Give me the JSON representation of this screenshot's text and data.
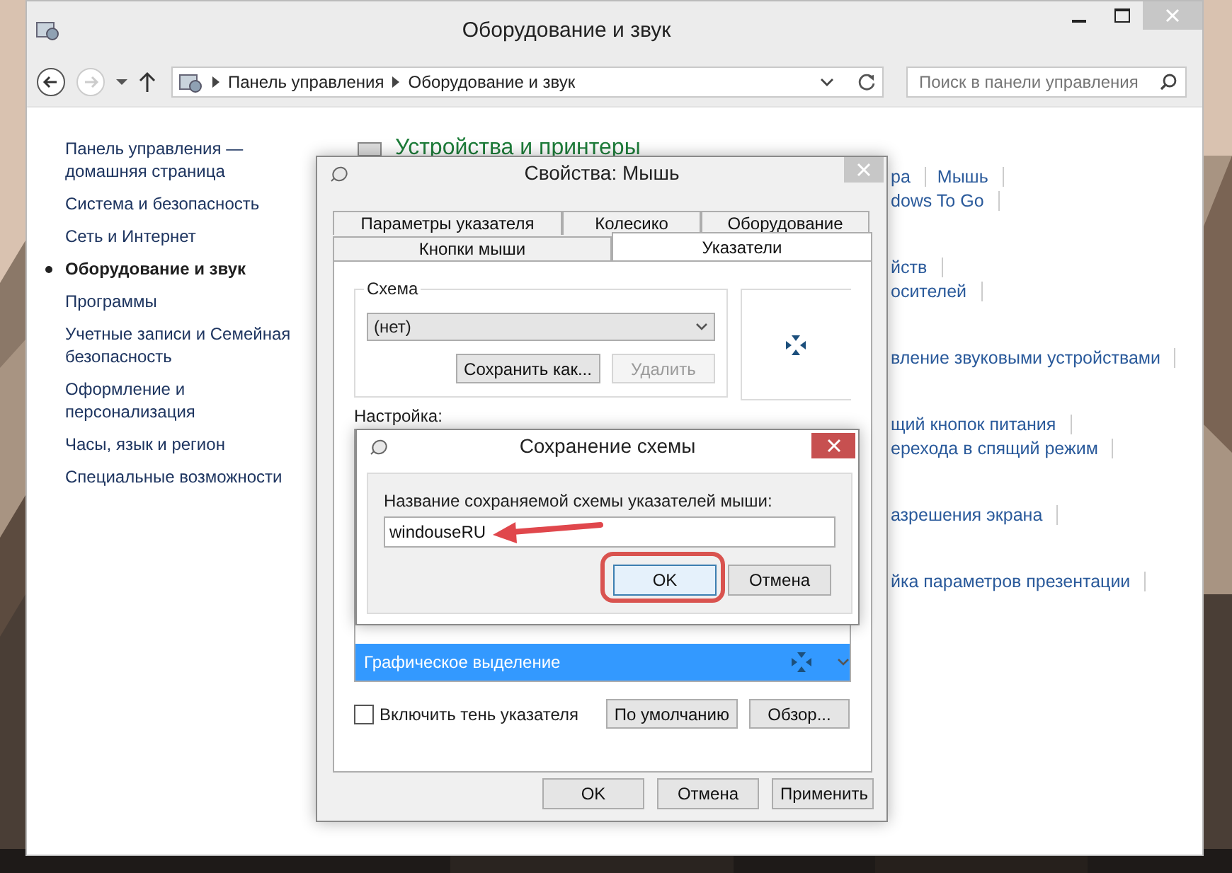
{
  "window": {
    "title": "Оборудование и звук"
  },
  "nav": {
    "back_disabled": false,
    "forward_disabled": true,
    "breadcrumbs": [
      "Панель управления",
      "Оборудование и звук"
    ],
    "search": {
      "placeholder": "Поиск в панели управления"
    }
  },
  "sidebar": {
    "items": [
      {
        "label": "Панель управления — домашняя страница",
        "selected": false
      },
      {
        "label": "Система и безопасность",
        "selected": false
      },
      {
        "label": "Сеть и Интернет",
        "selected": false
      },
      {
        "label": "Оборудование и звук",
        "selected": true
      },
      {
        "label": "Программы",
        "selected": false
      },
      {
        "label": "Учетные записи и Семейная безопасность",
        "selected": false
      },
      {
        "label": "Оформление и персонализация",
        "selected": false
      },
      {
        "label": "Часы, язык и регион",
        "selected": false
      },
      {
        "label": "Специальные возможности",
        "selected": false
      }
    ]
  },
  "content": {
    "heading": "Устройства и принтеры",
    "sections": [
      {
        "lines": [
          [
            "ра",
            "Мышь"
          ],
          [
            "dows To Go"
          ]
        ]
      },
      {
        "lines": [
          [
            "йств"
          ],
          [
            "осителей"
          ]
        ]
      },
      {
        "lines": [
          [
            "вление звуковыми устройствами"
          ]
        ]
      },
      {
        "lines": [
          [
            "щий кнопок питания"
          ],
          [
            "ерехода в спящий режим"
          ]
        ]
      },
      {
        "lines": [
          [
            "азрешения экрана"
          ]
        ]
      },
      {
        "lines": [
          [
            "йка параметров презентации"
          ]
        ]
      }
    ]
  },
  "mouse_dialog": {
    "title": "Свойства: Мышь",
    "tab_rows": [
      [
        {
          "label": "Параметры указателя",
          "selected": false
        },
        {
          "label": "Колесико",
          "selected": false
        },
        {
          "label": "Оборудование",
          "selected": false
        }
      ],
      [
        {
          "label": "Кнопки мыши",
          "selected": false
        },
        {
          "label": "Указатели",
          "selected": true
        }
      ]
    ],
    "scheme": {
      "label": "Схема",
      "value": "(нет)",
      "buttons": [
        {
          "label": "Сохранить как...",
          "disabled": false
        },
        {
          "label": "Удалить",
          "disabled": true
        }
      ]
    },
    "customize_label": "Настройка:",
    "cursor_list": [
      {
        "label": "Графическое выделение",
        "selected": true
      }
    ],
    "shadow_checkbox": {
      "label": "Включить тень указателя",
      "checked": false
    },
    "list_buttons": [
      "По умолчанию",
      "Обзор..."
    ],
    "footer_buttons": [
      "OK",
      "Отмена",
      "Применить"
    ]
  },
  "save_dialog": {
    "title": "Сохранение схемы",
    "prompt": "Название сохраняемой схемы указателей мыши:",
    "value": "windouseRU",
    "buttons": [
      {
        "label": "OK",
        "focused": true
      },
      {
        "label": "Отмена",
        "focused": false
      }
    ]
  }
}
